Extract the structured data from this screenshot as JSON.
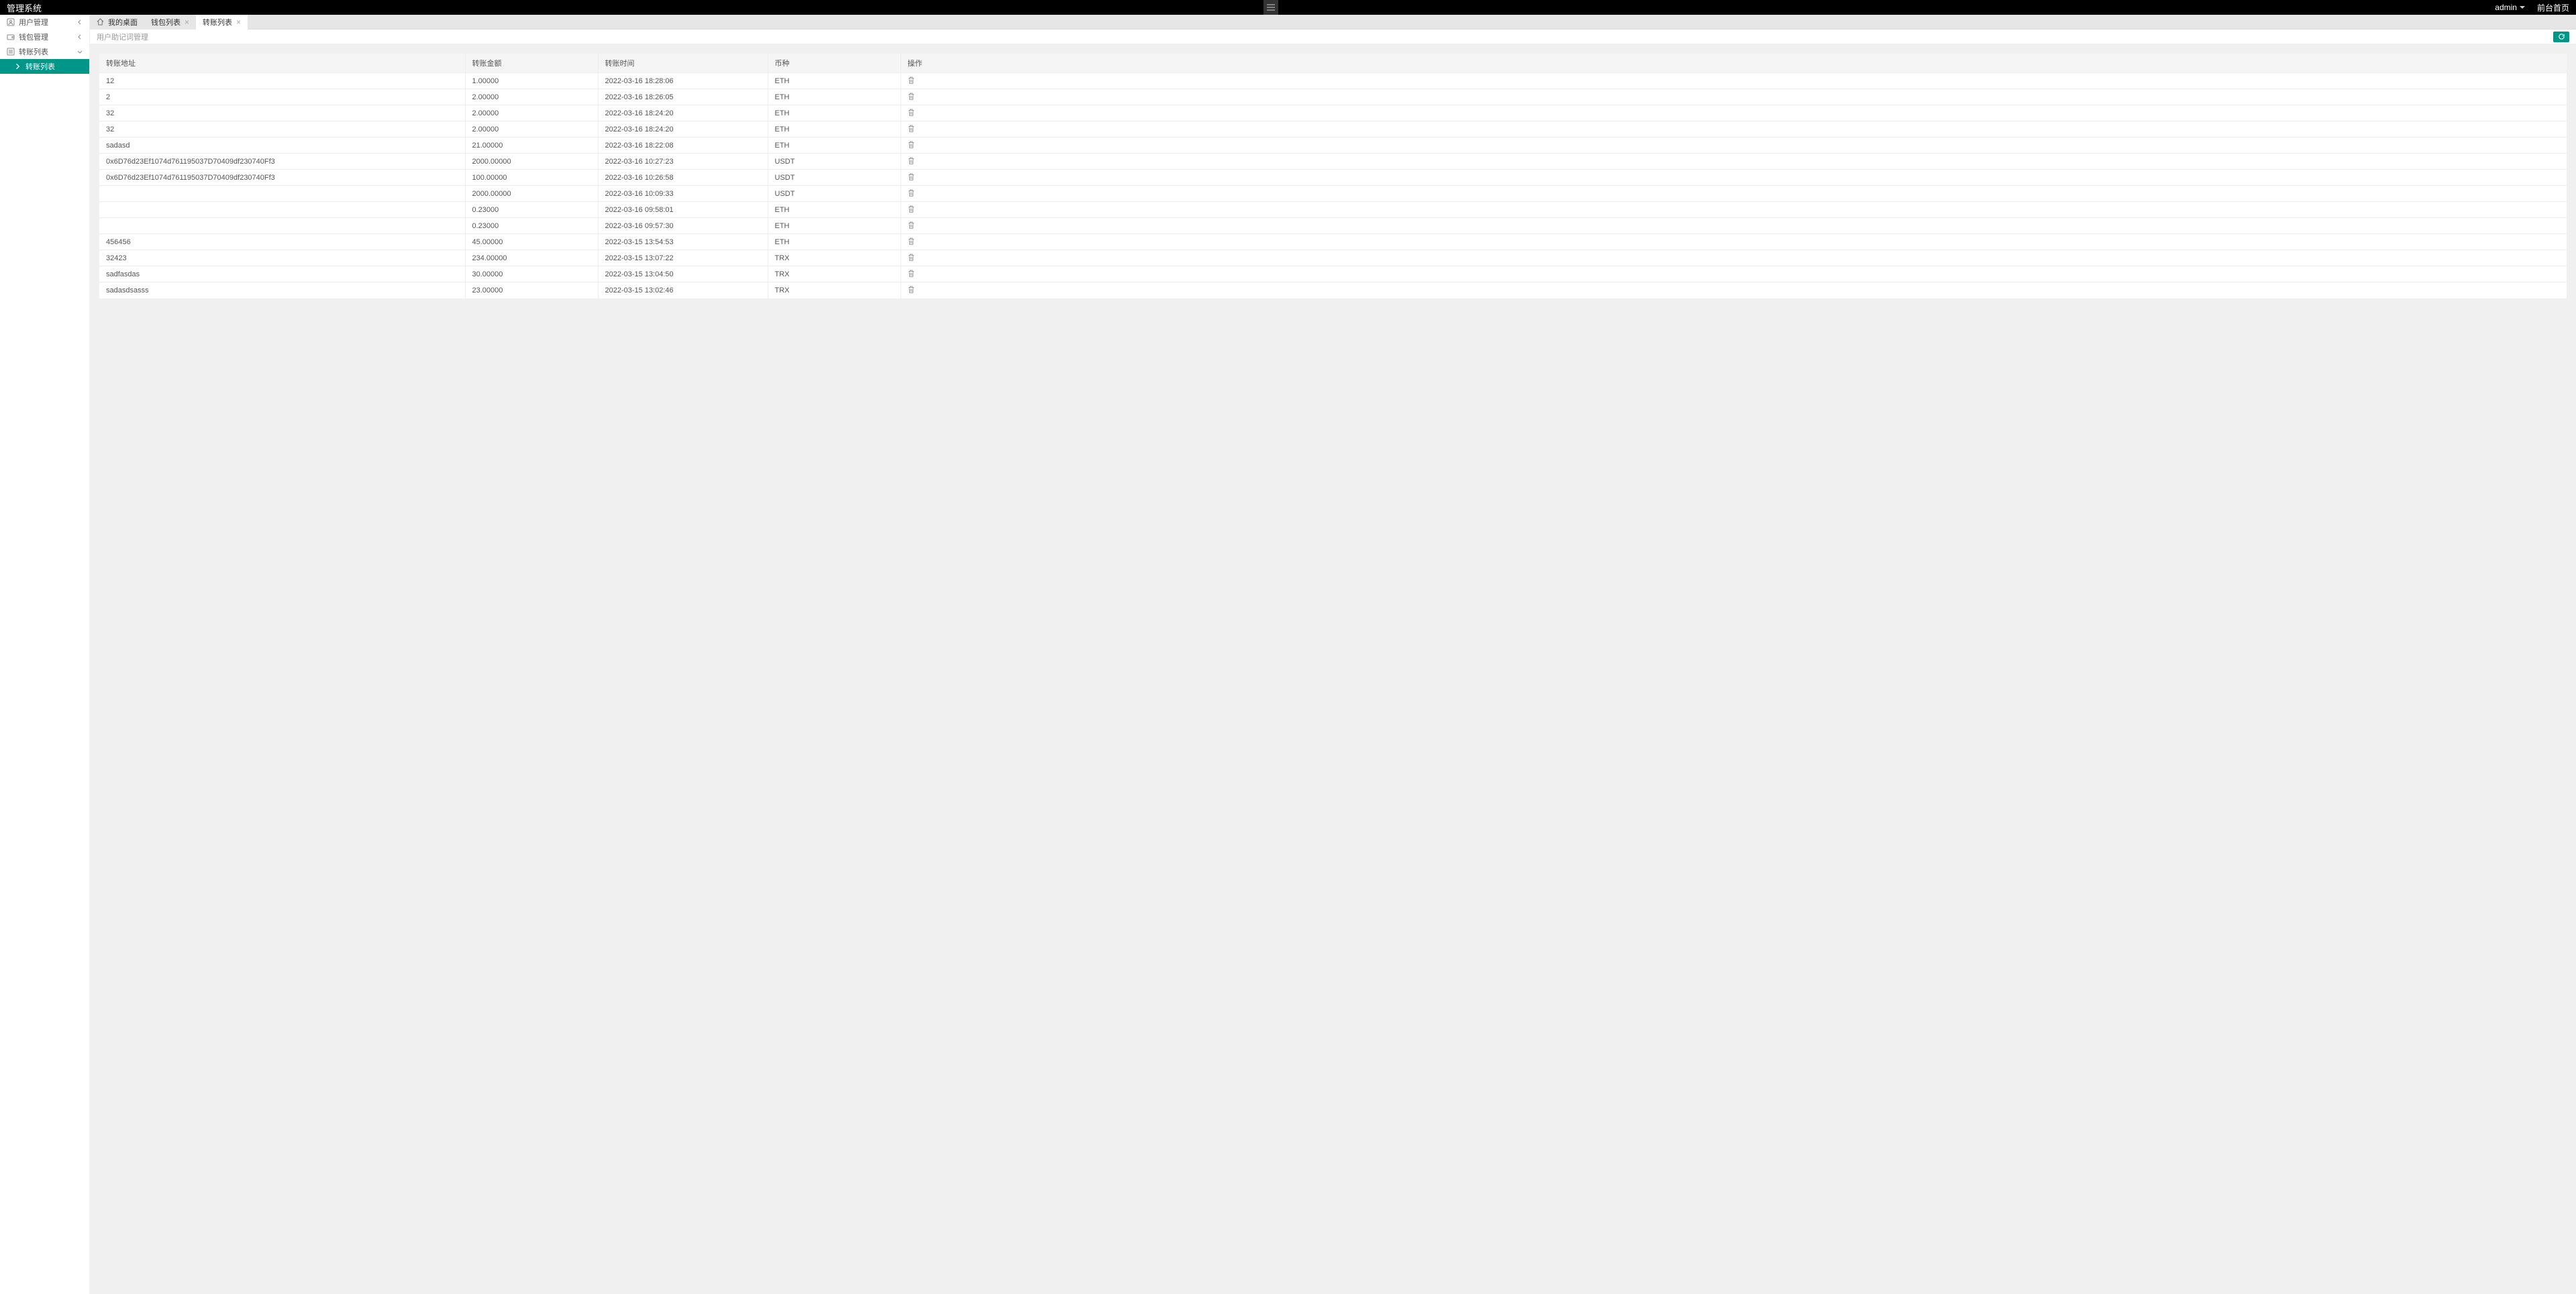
{
  "app_title": "管理系统",
  "header": {
    "user": "admin",
    "frontend_link": "前台首页"
  },
  "sidebar": {
    "items": [
      {
        "label": "用户管理",
        "expanded": false
      },
      {
        "label": "钱包管理",
        "expanded": false
      },
      {
        "label": "转账列表",
        "expanded": true
      }
    ],
    "sub_item": "转账列表"
  },
  "tabs": {
    "home": "我的桌面",
    "items": [
      {
        "label": "钱包列表",
        "active": false
      },
      {
        "label": "转账列表",
        "active": true
      }
    ]
  },
  "page_title": "用户助记词管理",
  "columns": {
    "address": "转账地址",
    "amount": "转账金额",
    "time": "转账时间",
    "coin": "币种",
    "op": "操作"
  },
  "rows": [
    {
      "address": "12",
      "amount": "1.00000",
      "time": "2022-03-16 18:28:06",
      "coin": "ETH"
    },
    {
      "address": "2",
      "amount": "2.00000",
      "time": "2022-03-16 18:26:05",
      "coin": "ETH"
    },
    {
      "address": "32",
      "amount": "2.00000",
      "time": "2022-03-16 18:24:20",
      "coin": "ETH"
    },
    {
      "address": "32",
      "amount": "2.00000",
      "time": "2022-03-16 18:24:20",
      "coin": "ETH"
    },
    {
      "address": "sadasd",
      "amount": "21.00000",
      "time": "2022-03-16 18:22:08",
      "coin": "ETH"
    },
    {
      "address": "0x6D76d23Ef1074d761195037D70409df230740Ff3",
      "amount": "2000.00000",
      "time": "2022-03-16 10:27:23",
      "coin": "USDT"
    },
    {
      "address": "0x6D76d23Ef1074d761195037D70409df230740Ff3",
      "amount": "100.00000",
      "time": "2022-03-16 10:26:58",
      "coin": "USDT"
    },
    {
      "address": "",
      "amount": "2000.00000",
      "time": "2022-03-16 10:09:33",
      "coin": "USDT"
    },
    {
      "address": "",
      "amount": "0.23000",
      "time": "2022-03-16 09:58:01",
      "coin": "ETH"
    },
    {
      "address": "",
      "amount": "0.23000",
      "time": "2022-03-16 09:57:30",
      "coin": "ETH"
    },
    {
      "address": "456456",
      "amount": "45.00000",
      "time": "2022-03-15 13:54:53",
      "coin": "ETH"
    },
    {
      "address": "32423",
      "amount": "234.00000",
      "time": "2022-03-15 13:07:22",
      "coin": "TRX"
    },
    {
      "address": "sadfasdas",
      "amount": "30.00000",
      "time": "2022-03-15 13:04:50",
      "coin": "TRX"
    },
    {
      "address": "sadasdsasss",
      "amount": "23.00000",
      "time": "2022-03-15 13:02:46",
      "coin": "TRX"
    }
  ]
}
